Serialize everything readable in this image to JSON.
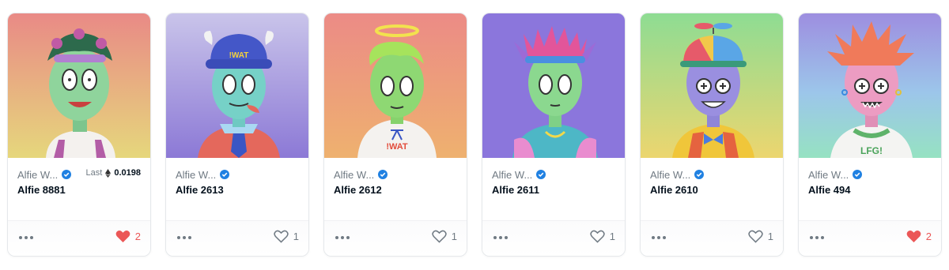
{
  "colors": {
    "verified": "#2081e2",
    "heart_liked": "#eb5757",
    "muted_text": "#707a83"
  },
  "cards": [
    {
      "collection": "Alfie W...",
      "name": "Alfie 8881",
      "last_label": "Last",
      "last_price": "0.0198",
      "likes": "2",
      "liked": true,
      "icons": {
        "verified": "verified-badge-icon",
        "more": "more-options-icon",
        "favorite": "heart-filled-icon"
      }
    },
    {
      "collection": "Alfie W...",
      "name": "Alfie 2613",
      "likes": "1",
      "liked": false,
      "icons": {
        "verified": "verified-badge-icon",
        "more": "more-options-icon",
        "favorite": "heart-outline-icon"
      }
    },
    {
      "collection": "Alfie W...",
      "name": "Alfie 2612",
      "likes": "1",
      "liked": false,
      "icons": {
        "verified": "verified-badge-icon",
        "more": "more-options-icon",
        "favorite": "heart-outline-icon"
      }
    },
    {
      "collection": "Alfie W...",
      "name": "Alfie 2611",
      "likes": "1",
      "liked": false,
      "icons": {
        "verified": "verified-badge-icon",
        "more": "more-options-icon",
        "favorite": "heart-outline-icon"
      }
    },
    {
      "collection": "Alfie W...",
      "name": "Alfie 2610",
      "likes": "1",
      "liked": false,
      "icons": {
        "verified": "verified-badge-icon",
        "more": "more-options-icon",
        "favorite": "heart-outline-icon"
      }
    },
    {
      "collection": "Alfie W...",
      "name": "Alfie 494",
      "likes": "2",
      "liked": true,
      "icons": {
        "verified": "verified-badge-icon",
        "more": "more-options-icon",
        "favorite": "heart-filled-icon"
      }
    }
  ],
  "artwork_text": {
    "hat_logo": "!WAT",
    "hoodie_logo": "!WAT",
    "shirt_logo": "LFG!"
  }
}
